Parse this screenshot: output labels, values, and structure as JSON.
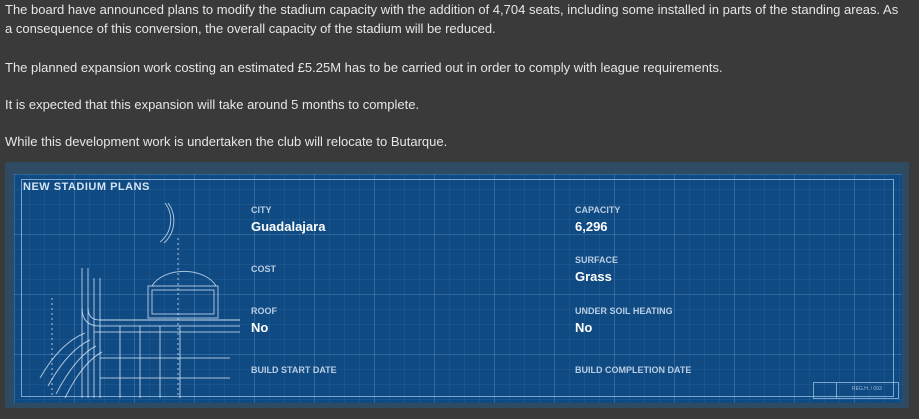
{
  "news": {
    "paragraph1": "The board have announced plans to modify the stadium capacity with the addition of 4,704 seats, including some installed in parts of the standing areas. As a consequence of this conversion, the overall capacity of the stadium will be reduced.",
    "paragraph2": "The planned expansion work costing an estimated £5.25M has to be carried out in order to comply with league requirements.",
    "paragraph3": "It is expected that this expansion will take around 5 months to complete.",
    "paragraph4": "While this development work is undertaken the club will relocate to Butarque."
  },
  "plans": {
    "title": "NEW STADIUM PLANS",
    "city_label": "CITY",
    "city_value": "Guadalajara",
    "capacity_label": "CAPACITY",
    "capacity_value": "6,296",
    "cost_label": "COST",
    "cost_value": "",
    "surface_label": "SURFACE",
    "surface_value": "Grass",
    "roof_label": "ROOF",
    "roof_value": "No",
    "heating_label": "UNDER SOIL HEATING",
    "heating_value": "No",
    "start_label": "BUILD START DATE",
    "start_value": "",
    "completion_label": "BUILD COMPLETION DATE",
    "completion_value": "",
    "stamp_text": "REG.H. / 093"
  },
  "colors": {
    "page_bg": "#3a3a3a",
    "blueprint_bg": "#0f4a82",
    "frame": "#2f4a63"
  }
}
